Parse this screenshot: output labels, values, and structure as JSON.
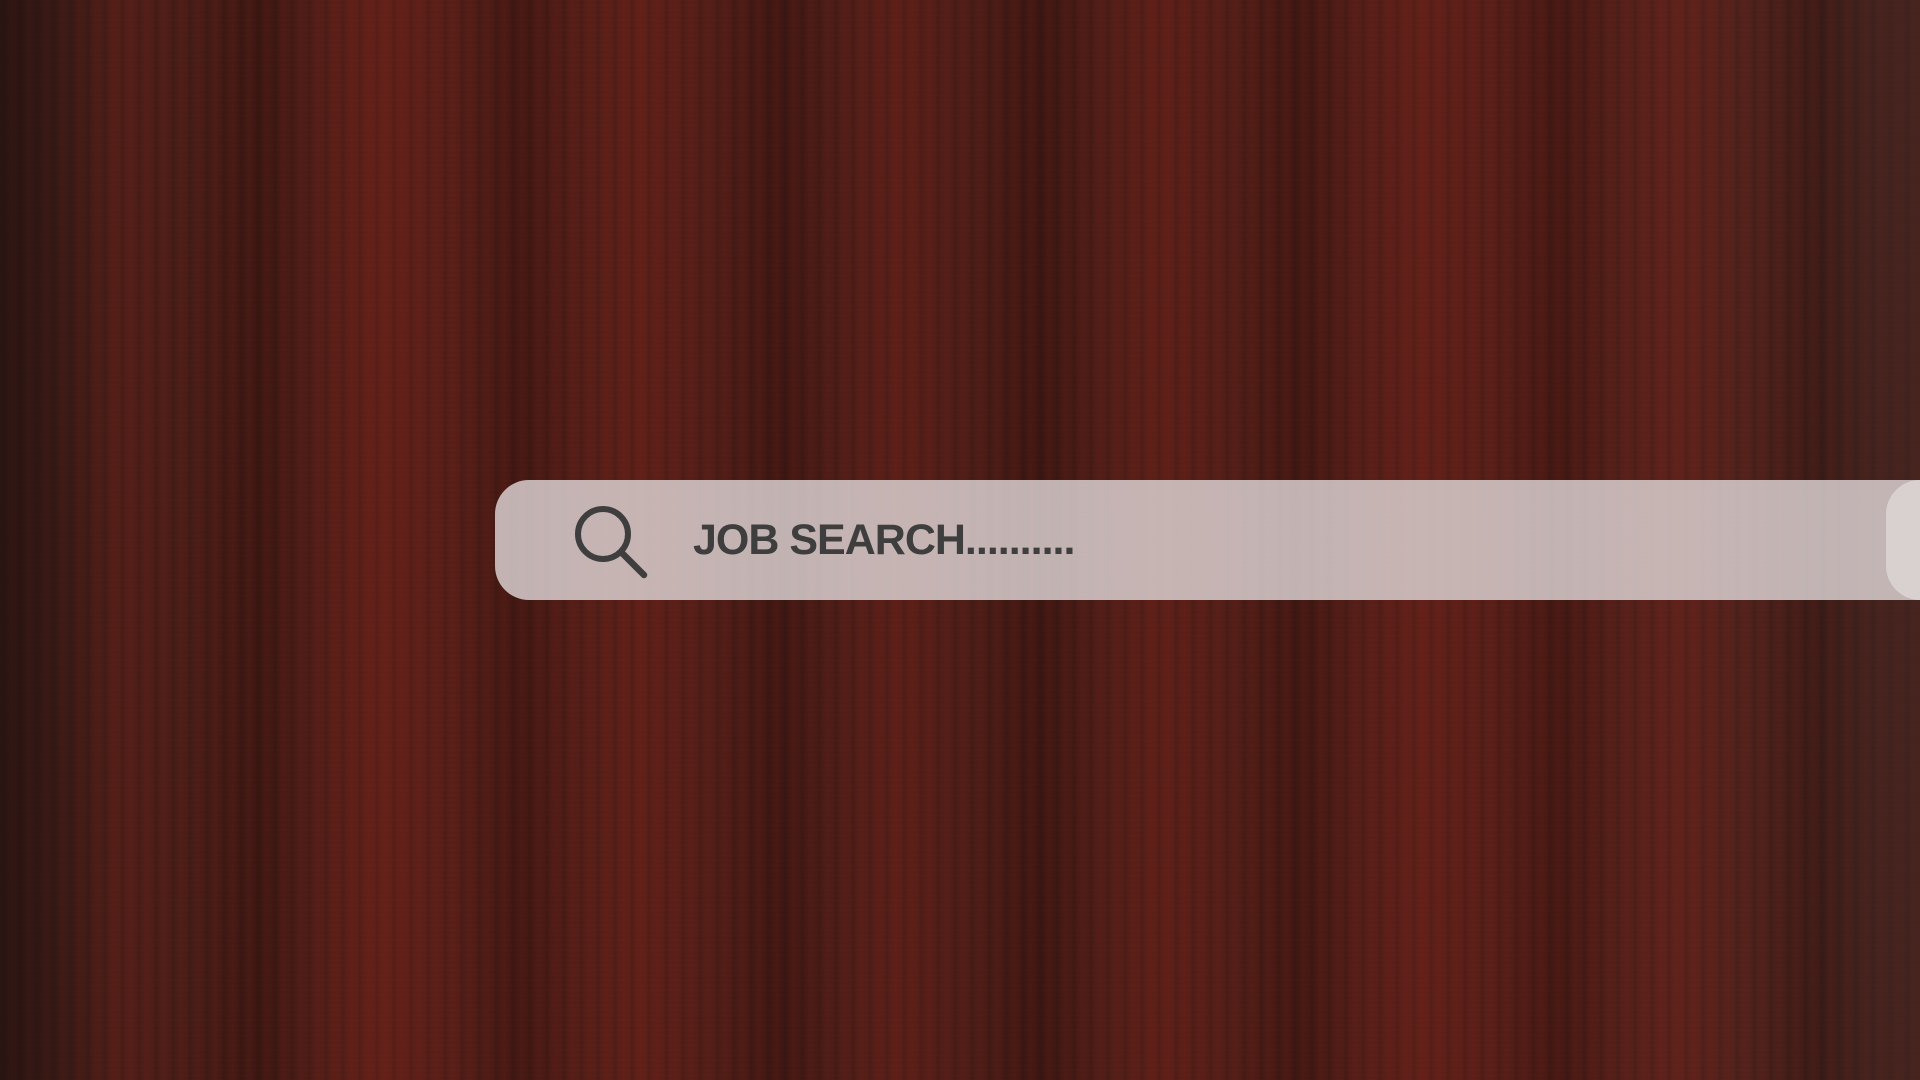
{
  "background": {
    "base_color": "#4a1f1a",
    "texture": "red-brown grunge fabric"
  },
  "search": {
    "icon": "search-icon",
    "text": "JOB SEARCH..........",
    "bar_color": "#ded6d6",
    "text_color": "#3f3e3e"
  }
}
